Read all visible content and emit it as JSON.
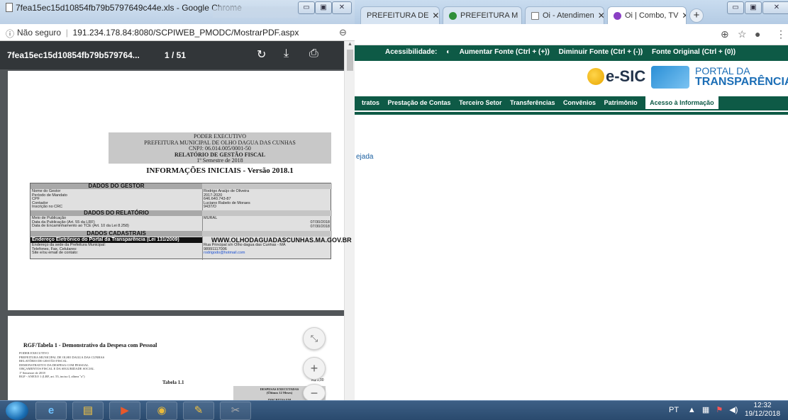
{
  "left_window": {
    "title": "7fea15ec15d10854fb79b5797649c44e.xls - Google Chrome",
    "address": {
      "security": "Não seguro",
      "url": "191.234.178.84:8080/SCPIWEB_PMODC/MostrarPDF.aspx"
    },
    "pdf_toolbar": {
      "filename": "7fea15ec15d10854fb79b579764...",
      "page_indicator": "1 / 51"
    },
    "page1": {
      "header": {
        "line1": "PODER EXECUTIVO",
        "line2": "PREFEITURA MUNICIPAL DE OLHO DAGUA DAS CUNHAS",
        "line3": "CNPJ: 06.014.005/0001-50",
        "line4": "RELATÓRIO DE GESTÃO FISCAL",
        "line5": "1º Semestre de 2018"
      },
      "title": "INFORMAÇÕES INICIAIS - Versão 2018.1",
      "sec_gestor": "DADOS DO GESTOR",
      "gestor_labels": "Nome do Gestor\nPeríodo de Mandato\nCPF\nContador\nInscrição no CRC",
      "gestor_values": "Rodrigo Araújo de Oliveira\n2017-2020\n646.640.743-87\nLuciano Rabelo de Moraes\n9437/O",
      "sec_relatorio": "DADOS DO RELATÓRIO",
      "rel_labels": "Meio de Publicação\nData da Publicação (Art. 55 da LRF)\nData de Encaminhamento ao TCE (Art. 10 da Lei 8.258)",
      "rel_values_left": "MURAL",
      "rel_values_right": "07/30/2018\n07/30/2018",
      "sec_cadastrais": "DADOS CADASTRAIS",
      "portal_label": "Endereço Eletrônico do Portal da Transparência (Lei 131/2009)",
      "portal_url": "WWW.OLHODAGUADASCUNHAS.MA.GOV.BR",
      "cad_labels": "Endereço da sede da Prefeitura Municipal:\nTelefones, Fax, Celulares:\nSite e/ou email de contato:",
      "cad_values": "Rua Principal s/n Olho dagua das Cunhas - MA\n98991117006",
      "cad_email": "rodrigodo@hotmail.com"
    },
    "page2": {
      "title": "RGF/Tabela 1 - Demonstrativo da Despesa com Pessoal",
      "lines": "PODER EXECUTIVO\nPREFEITURA MUNICIPAL DE OLHO DAGUA DAS CUNHAS\nRELATÓRIO DE GESTÃO FISCAL\nDEMONSTRATIVO DA DESPESA COM PESSOAL\nORÇAMENTOS FISCAL E DA SEGURIDADE SOCIAL\n1º Semestre de 2018\nRGF - ANEXO 1 (LRF, art. 55, inciso I, alínea \"a\")",
      "table_label": "Tabela 1.1",
      "grey_header": "DESPESAS EXECUTADAS\n(Últimos 12 Meses)\n\nINSCRITAS EM",
      "currency_mark": "R$ 1,00"
    }
  },
  "right_window": {
    "tabs": [
      {
        "label": "PREFEITURA DE"
      },
      {
        "label": "PREFEITURA M"
      },
      {
        "label": "Oi - Atendimen"
      },
      {
        "label": "Oi | Combo, TV"
      }
    ],
    "accessibility_bar": {
      "label": "Acessibilidade:",
      "increase": "Aumentar Fonte (Ctrl + (+))",
      "decrease": "Diminuir Fonte (Ctrl + (-))",
      "original": "Fonte Original (Ctrl + (0))"
    },
    "esic_label": "e-SIC",
    "portal_line1": "PORTAL DA",
    "portal_line2": "TRANSPARÊNCIA",
    "nav": [
      "tratos",
      "Prestação de Contas",
      "Terceiro Setor",
      "Transferências",
      "Convênios",
      "Patrimônio",
      "Acesso à Informação"
    ],
    "body_fragment": "ejada"
  },
  "taskbar": {
    "language": "PT",
    "time": "12:32",
    "date": "19/12/2018"
  },
  "colors": {
    "site_green": "#0e5a46",
    "pdf_toolbar": "#323639",
    "pdf_bg": "#525659"
  }
}
